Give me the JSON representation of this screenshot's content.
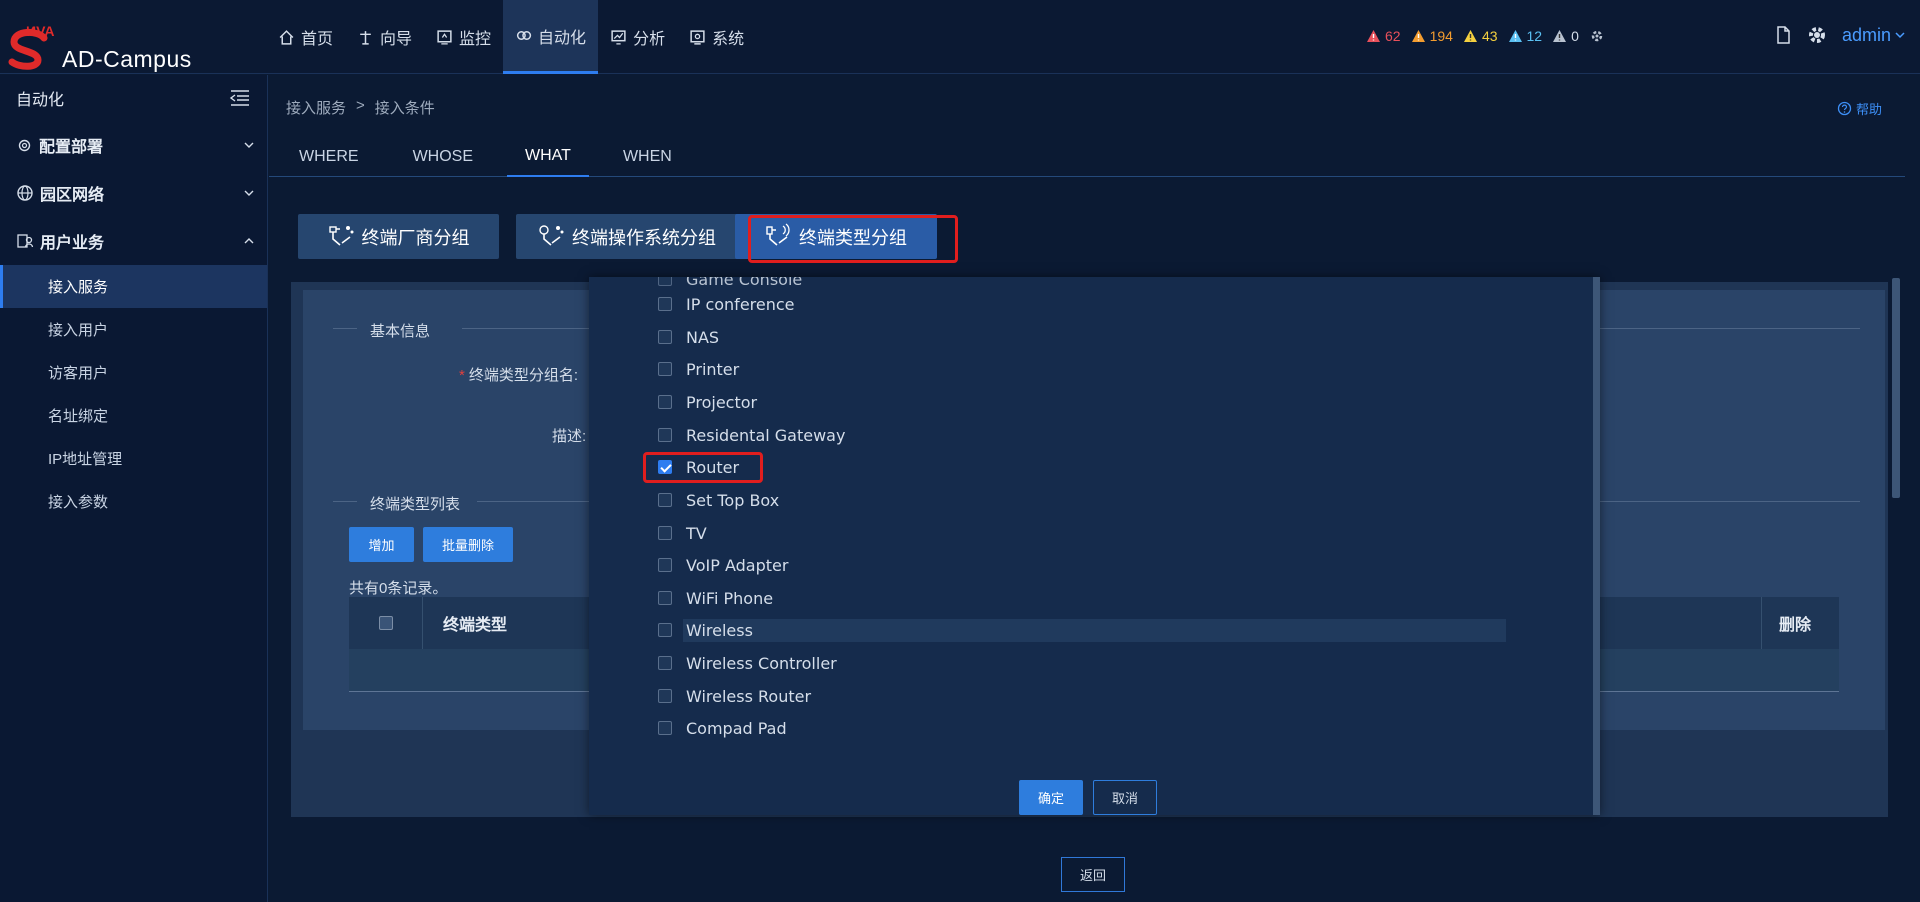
{
  "brand": {
    "logo_text": "ИVA",
    "name": "AD-Campus"
  },
  "nav": {
    "items": [
      {
        "label": "首页",
        "icon": "home-icon"
      },
      {
        "label": "向导",
        "icon": "guide-icon"
      },
      {
        "label": "监控",
        "icon": "monitor-icon"
      },
      {
        "label": "自动化",
        "icon": "automation-icon",
        "active": true
      },
      {
        "label": "分析",
        "icon": "analysis-icon"
      },
      {
        "label": "系统",
        "icon": "system-icon"
      }
    ]
  },
  "alarms": [
    {
      "count": "62",
      "color": "#e8505b"
    },
    {
      "count": "194",
      "color": "#f39c2f"
    },
    {
      "count": "43",
      "color": "#f4d03f"
    },
    {
      "count": "12",
      "color": "#5bc0f2"
    },
    {
      "count": "0",
      "color": "#b8c2d0"
    }
  ],
  "user": {
    "name": "admin"
  },
  "sidebar": {
    "title": "自动化",
    "groups": [
      {
        "label": "配置部署",
        "icon": "config-icon",
        "expanded": false
      },
      {
        "label": "园区网络",
        "icon": "globe-icon",
        "expanded": false
      },
      {
        "label": "用户业务",
        "icon": "users-icon",
        "expanded": true
      }
    ],
    "items": [
      {
        "label": "接入服务",
        "active": true
      },
      {
        "label": "接入用户"
      },
      {
        "label": "访客用户"
      },
      {
        "label": "名址绑定"
      },
      {
        "label": "IP地址管理"
      },
      {
        "label": "接入参数"
      }
    ]
  },
  "breadcrumb": {
    "root": "接入服务",
    "sep": ">",
    "current": "接入条件"
  },
  "help_label": "帮助",
  "tabs": [
    {
      "label": "WHERE"
    },
    {
      "label": "WHOSE"
    },
    {
      "label": "WHAT",
      "active": true
    },
    {
      "label": "WHEN"
    }
  ],
  "group_buttons": [
    {
      "label": "终端厂商分组"
    },
    {
      "label": "终端操作系统分组"
    },
    {
      "label": "终端类型分组",
      "active": true
    }
  ],
  "form": {
    "section_basic": "基本信息",
    "name_label": "终端类型分组名:",
    "desc_label": "描述:",
    "section_list": "终端类型列表",
    "add_button": "增加",
    "batch_delete_button": "批量删除",
    "records": "共有0条记录。",
    "col_type": "终端类型",
    "col_delete": "删除"
  },
  "dropdown": {
    "partial_top": "Game Console",
    "options": [
      {
        "label": "IP conference",
        "checked": false
      },
      {
        "label": "NAS",
        "checked": false
      },
      {
        "label": "Printer",
        "checked": false
      },
      {
        "label": "Projector",
        "checked": false
      },
      {
        "label": "Residental Gateway",
        "checked": false
      },
      {
        "label": "Router",
        "checked": true
      },
      {
        "label": "Set Top Box",
        "checked": false
      },
      {
        "label": "TV",
        "checked": false
      },
      {
        "label": "VoIP Adapter",
        "checked": false
      },
      {
        "label": "WiFi Phone",
        "checked": false
      },
      {
        "label": "Wireless",
        "checked": false
      },
      {
        "label": "Wireless Controller",
        "checked": false
      },
      {
        "label": "Wireless Router",
        "checked": false
      },
      {
        "label": "Compad Pad",
        "checked": false
      }
    ],
    "ok": "确定",
    "cancel": "取消"
  },
  "back_button": "返回"
}
